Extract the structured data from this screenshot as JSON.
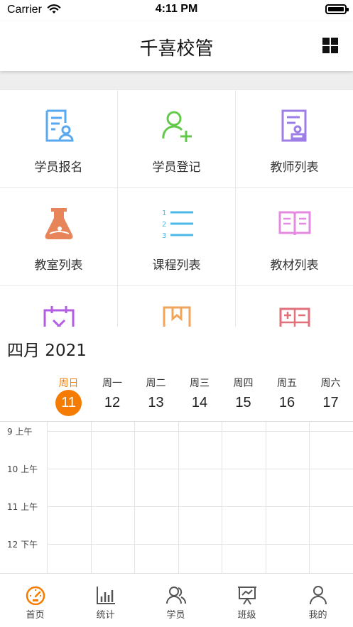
{
  "status_bar": {
    "carrier": "Carrier",
    "time": "4:11 PM",
    "battery_level": 1.0
  },
  "nav": {
    "title": "千喜校管",
    "grid_icon": "grid-icon"
  },
  "menu": {
    "items": [
      {
        "label": "学员报名",
        "icon": "student-register-icon",
        "color": "#5aa9f0"
      },
      {
        "label": "学员登记",
        "icon": "add-user-icon",
        "color": "#63c94a"
      },
      {
        "label": "教师列表",
        "icon": "teacher-doc-icon",
        "color": "#9c7ee6"
      },
      {
        "label": "教室列表",
        "icon": "flask-icon",
        "color": "#e8845a"
      },
      {
        "label": "课程列表",
        "icon": "numbered-list-icon",
        "color": "#4ab8e8"
      },
      {
        "label": "教材列表",
        "icon": "book-icon",
        "color": "#e58ae0"
      },
      {
        "label": "",
        "icon": "calendar-icon",
        "color": "#b35ee0"
      },
      {
        "label": "",
        "icon": "bookmark-icon",
        "color": "#f0a55a"
      },
      {
        "label": "",
        "icon": "calculator-icon",
        "color": "#e0707a"
      }
    ]
  },
  "calendar": {
    "month_title": "四月 2021",
    "weekdays": [
      {
        "name": "周日",
        "date": "11",
        "selected": true
      },
      {
        "name": "周一",
        "date": "12",
        "selected": false
      },
      {
        "name": "周二",
        "date": "13",
        "selected": false
      },
      {
        "name": "周三",
        "date": "14",
        "selected": false
      },
      {
        "name": "周四",
        "date": "15",
        "selected": false
      },
      {
        "name": "周五",
        "date": "16",
        "selected": false
      },
      {
        "name": "周六",
        "date": "17",
        "selected": false
      }
    ],
    "hours": [
      "9 上午",
      "10 上午",
      "11 上午",
      "12 下午"
    ],
    "accent": "#f57c00"
  },
  "tabs": [
    {
      "label": "首页",
      "icon": "dashboard-icon",
      "active": true
    },
    {
      "label": "统计",
      "icon": "bar-chart-icon",
      "active": false
    },
    {
      "label": "学员",
      "icon": "users-icon",
      "active": false
    },
    {
      "label": "班级",
      "icon": "presentation-icon",
      "active": false
    },
    {
      "label": "我的",
      "icon": "profile-icon",
      "active": false
    }
  ]
}
